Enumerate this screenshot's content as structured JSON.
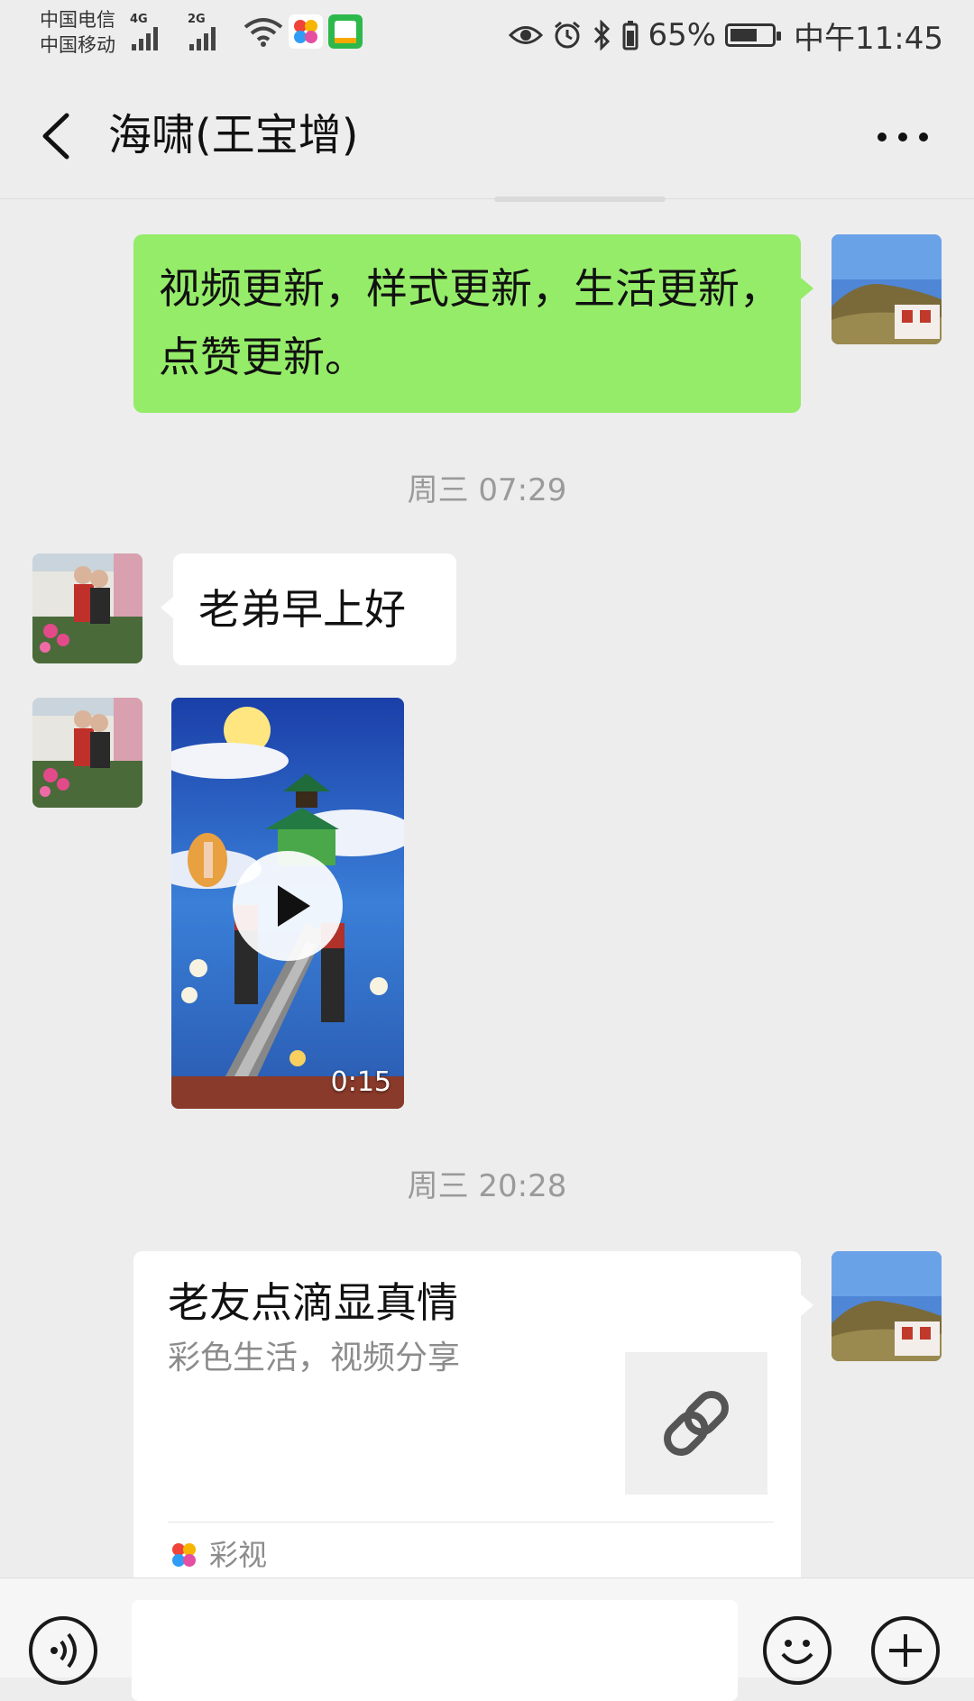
{
  "status_bar": {
    "carrier1": "中国电信",
    "carrier2": "中国移动",
    "net1": "4G",
    "net2": "2G",
    "battery_percent": "65%",
    "battery_level": 0.65,
    "time": "中午11:45"
  },
  "header": {
    "title": "海啸(王宝增)",
    "back_icon": "chevron-left-icon",
    "more_icon": "more-dots-icon"
  },
  "messages": [
    {
      "side": "right",
      "type": "text",
      "text": "视频更新，样式更新，生活更新，点赞更新。"
    },
    {
      "type": "timestamp",
      "text": "周三 07:29"
    },
    {
      "side": "left",
      "type": "text",
      "text": "老弟早上好"
    },
    {
      "side": "left",
      "type": "video",
      "duration": "0:15"
    },
    {
      "type": "timestamp",
      "text": "周三 20:28"
    },
    {
      "side": "right",
      "type": "link",
      "title": "老友点滴显真情",
      "description": "彩色生活，视频分享",
      "source": "彩视"
    }
  ],
  "input_bar": {
    "voice_icon": "voice-icon",
    "emoji_icon": "emoji-icon",
    "plus_icon": "plus-icon"
  },
  "colors": {
    "background": "#ededed",
    "sent_bubble": "#95ec69",
    "received_bubble": "#ffffff",
    "timestamp": "#9a9a9a"
  }
}
